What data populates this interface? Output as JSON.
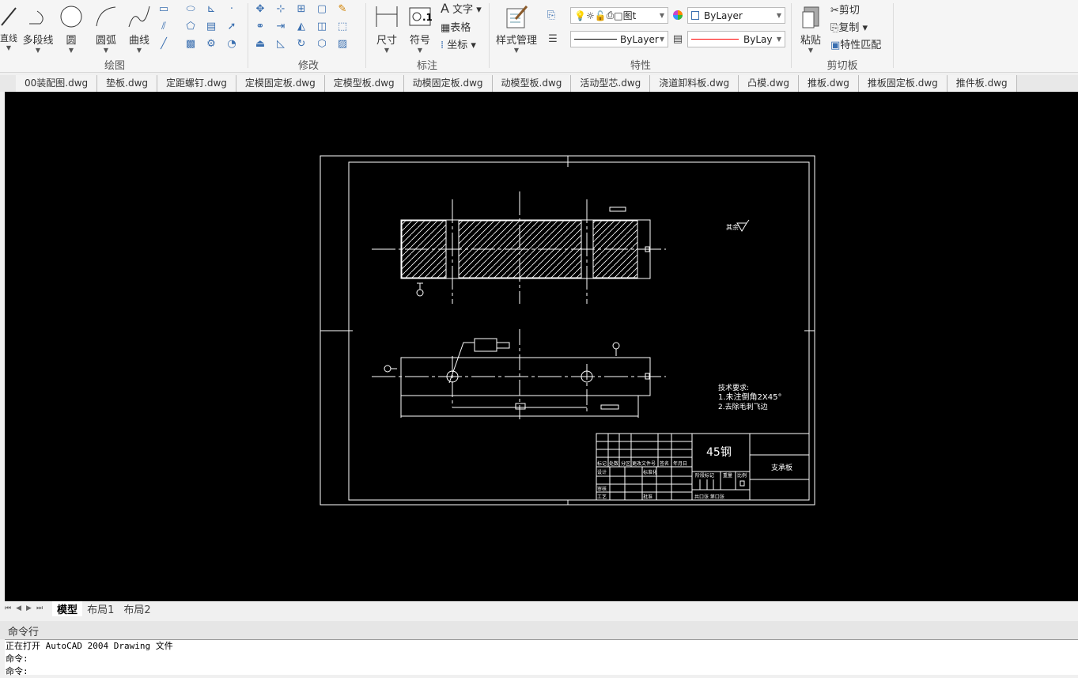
{
  "ribbon": {
    "draw": {
      "label": "绘图",
      "buttons": [
        {
          "label": "直线",
          "icon": "line-icon"
        },
        {
          "label": "多段线",
          "icon": "polyline-icon"
        },
        {
          "label": "圆",
          "icon": "circle-icon"
        },
        {
          "label": "圆弧",
          "icon": "arc-icon"
        },
        {
          "label": "曲线",
          "icon": "spline-icon"
        }
      ]
    },
    "modify": {
      "label": "修改"
    },
    "annotate": {
      "label": "标注",
      "dimension": "尺寸",
      "symbol": "符号",
      "text": "文字",
      "table": "表格",
      "coordinate": "坐标"
    },
    "properties": {
      "label": "特性",
      "style_manager": "样式管理",
      "layer": "图t",
      "color": "ByLayer",
      "linetype": "ByLayer",
      "lineweight": "ByLay",
      "accent": "#ff0000"
    },
    "clipboard": {
      "label": "剪切板",
      "paste": "粘贴",
      "cut": "剪切",
      "copy": "复制",
      "match": "特性匹配"
    }
  },
  "doc_tabs": [
    "00装配图.dwg",
    "垫板.dwg",
    "定距螺钉.dwg",
    "定模固定板.dwg",
    "定模型板.dwg",
    "动模固定板.dwg",
    "动模型板.dwg",
    "活动型芯.dwg",
    "浇道卸料板.dwg",
    "凸模.dwg",
    "推板.dwg",
    "推板固定板.dwg",
    "推件板.dwg"
  ],
  "drawing": {
    "material": "45钢",
    "part_name": "支承板",
    "title_headers": [
      "标记",
      "处数",
      "分区",
      "更改文件号",
      "签名",
      "年月日"
    ],
    "row_labels": [
      "设计",
      "标准化",
      "审核",
      "工艺",
      "批准"
    ],
    "stage_headers": [
      "阶段标记",
      "重量",
      "比例"
    ],
    "sheet": "共口张 第口张",
    "roughness_note": "其余",
    "tech_title": "技术要求:",
    "tech_notes": [
      "1.未注倒角2X45°",
      "2.去除毛刺飞边"
    ]
  },
  "layout_tabs": [
    "模型",
    "布局1",
    "布局2"
  ],
  "command": {
    "title": "命令行",
    "lines": [
      "正在打开 AutoCAD 2004 Drawing 文件",
      "命令:",
      "命令:"
    ]
  }
}
